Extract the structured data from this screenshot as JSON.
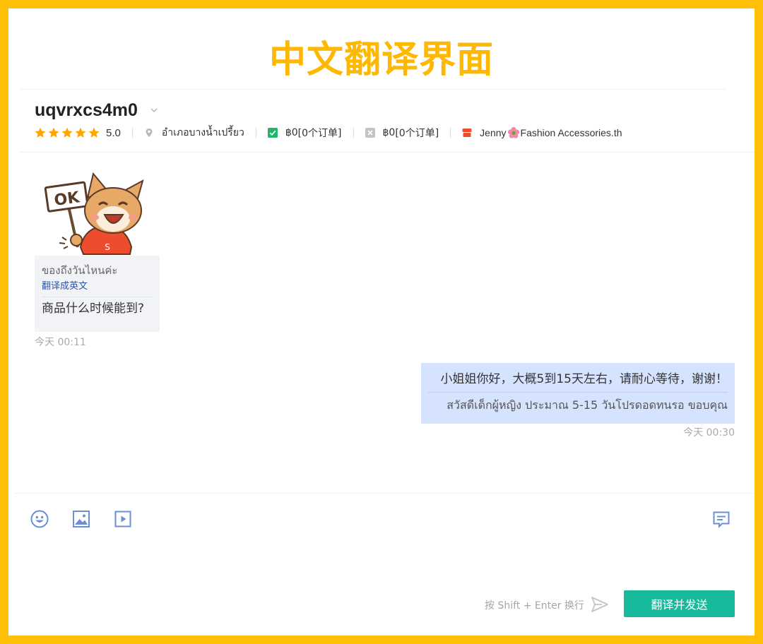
{
  "banner": {
    "title": "中文翻译界面"
  },
  "header": {
    "username": "uqvrxcs4m0",
    "rating": "5.0",
    "stars": 5,
    "location": "อำเภอบางน้ำเปรี้ยว",
    "completed": {
      "amount": "฿0",
      "orders": "[0个订单]"
    },
    "cancelled": {
      "amount": "฿0",
      "orders": "[0个订单]"
    },
    "shop": {
      "prefix": "Jenny",
      "suffix": "Fashion Accessories.th"
    }
  },
  "messages": {
    "incoming": {
      "original": "ของถึงวันไหนค่ะ",
      "translate_link": "翻译成英文",
      "translated": "商品什么时候能到?",
      "time": "今天 00:11"
    },
    "outgoing": {
      "text": "小姐姐你好，大概5到15天左右，请耐心等待，谢谢！",
      "translated": "สวัสดีเด็กผู้หญิง ประมาณ 5-15 วันโปรดอดทนรอ ขอบคุณ",
      "time": "今天 00:30"
    }
  },
  "composer": {
    "hint": "按 Shift + Enter 换行",
    "send_label": "翻译并发送"
  },
  "colors": {
    "accent": "#19b99b",
    "banner": "#FFB800",
    "outgoing_bubble": "#d6e3ff",
    "incoming_bubble": "#f1f3f7",
    "star": "#FFA500"
  }
}
